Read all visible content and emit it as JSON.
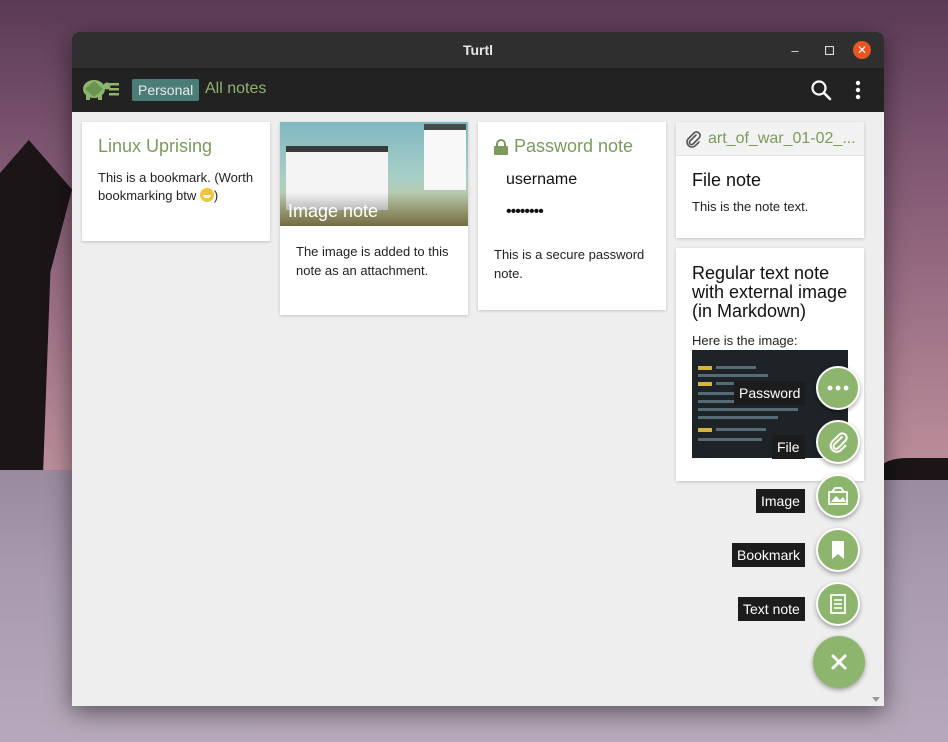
{
  "window": {
    "title": "Turtl"
  },
  "appbar": {
    "space": "Personal",
    "board": "All notes"
  },
  "notes": {
    "bookmark": {
      "title": "Linux Uprising",
      "text": "This is a bookmark. (Worth bookmarking btw ",
      "text_end": ")"
    },
    "image": {
      "title": "Image note",
      "text": "The image is added to this note as an attachment."
    },
    "password": {
      "title": "Password note",
      "username": "username",
      "password": "••••••••",
      "text": "This is a secure password note."
    },
    "file": {
      "filename": "art_of_war_01-02_...",
      "title": "File note",
      "text": "This is the note text."
    },
    "markdown": {
      "title": "Regular text note with external image (in Markdown)",
      "text": "Here is the image:"
    }
  },
  "fab_menu": {
    "password": "Password",
    "file": "File",
    "image": "Image",
    "bookmark": "Bookmark",
    "text_note": "Text note"
  },
  "colors": {
    "accent": "#8db56d",
    "title_green": "#7b9b5a",
    "space_badge": "#4a7d75",
    "close": "#e95420"
  }
}
